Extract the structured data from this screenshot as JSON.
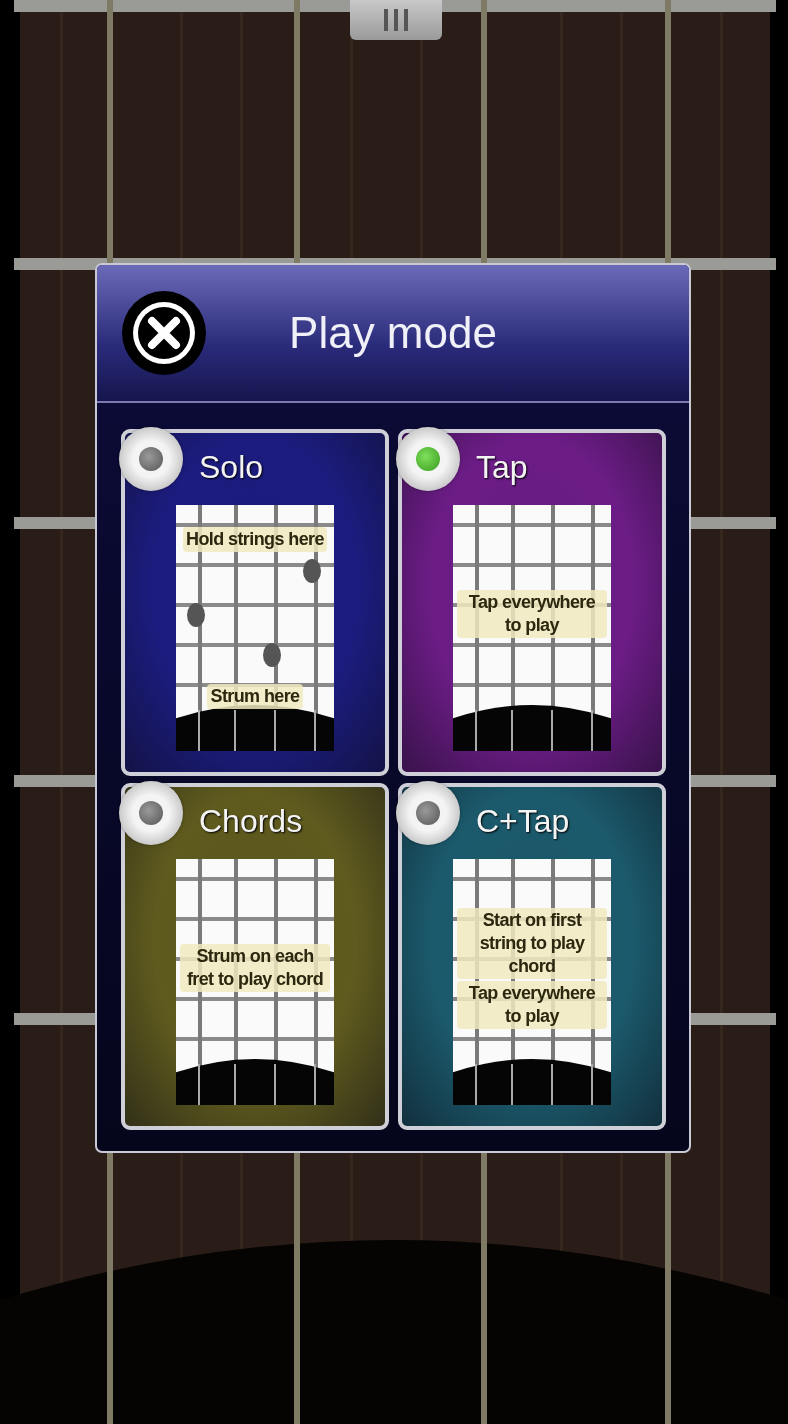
{
  "dialog": {
    "title": "Play mode"
  },
  "modes": [
    {
      "title": "Solo",
      "selected": false,
      "color": "#1c1c80",
      "kind": "split",
      "hints": [
        "Hold strings here",
        "Strum here"
      ]
    },
    {
      "title": "Tap",
      "selected": true,
      "color": "#6c1c86",
      "kind": "center",
      "hints": [
        "Tap everywhere to play"
      ]
    },
    {
      "title": "Chords",
      "selected": false,
      "color": "#5f5b1e",
      "kind": "center",
      "hints": [
        "Strum on each fret to play chord"
      ]
    },
    {
      "title": "C+Tap",
      "selected": false,
      "color": "#1b5a6c",
      "kind": "center",
      "hints": [
        "Start on first string to play chord",
        "Tap everywhere to play"
      ]
    }
  ]
}
